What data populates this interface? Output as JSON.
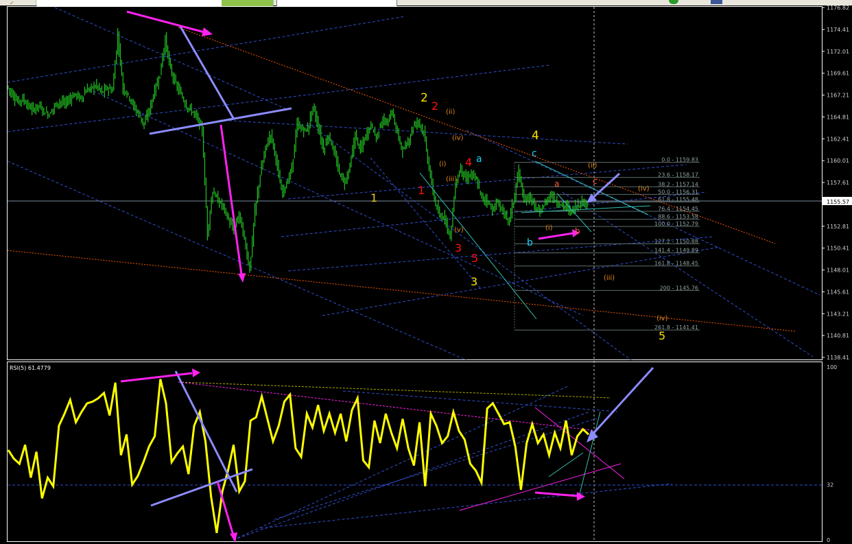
{
  "rsi_label": "RSI(5) 61.4779",
  "price_axis": [
    "1176.82",
    "1174.41",
    "1172.01",
    "1169.61",
    "1167.21",
    "1164.81",
    "1162.41",
    "1160.01",
    "1157.61",
    "1155.57",
    "1152.81",
    "1150.41",
    "1148.01",
    "1145.61",
    "1143.21",
    "1140.81",
    "1138.41"
  ],
  "current_price": "1155.57",
  "rsi_axis": [
    "100",
    "32",
    "0"
  ],
  "fib_levels": [
    "0.0 - 1159.83",
    "23.6 - 1158.17",
    "38.2 - 1157.14",
    "50.0 - 1156.31",
    "61.8 - 1155.48",
    "76.4 - 1154.45",
    "88.6 - 1153.58",
    "100.0 - 1152.79",
    "127.2 - 1150.88",
    "141.4 - 1149.89",
    "161.8 - 1148.45",
    "200 - 1145.76",
    "261.8 - 1141.41"
  ],
  "wave_labels": {
    "y1": "1",
    "y2": "2",
    "y3": "3",
    "y4": "4",
    "y5": "5",
    "r1": "1",
    "r2": "2",
    "r3": "3",
    "r4": "4",
    "r5": "5",
    "a_cyan": "a",
    "b_cyan": "b",
    "c_cyan": "c",
    "a_small": "a",
    "b_small": "b",
    "c_small": "c",
    "ii": "(ii)",
    "iii": "(iii)",
    "iv": "(iv)",
    "i": "(i)",
    "v": "(v)",
    "ii2": "(ii)",
    "iv2": "(iv)",
    "iii2": "(iii)",
    "iv3": "(iv)",
    "i2": "(i)"
  },
  "colors": {
    "candle": "#22c322",
    "rsi": "#ffff00",
    "magenta": "#ff22ee",
    "lavender": "#8c8cff",
    "channel": "#3050d0",
    "orange": "#ff5a00",
    "cyan": "#00e0e0"
  },
  "chart_data": {
    "type": "candlestick",
    "ylim": [
      1138.41,
      1176.82
    ],
    "current_price": 1155.57,
    "rsi": {
      "period": 5,
      "last": 61.4779,
      "ylim": [
        0,
        100
      ],
      "level": 32
    },
    "fib_retracement": [
      {
        "ratio": 0.0,
        "price": 1159.83
      },
      {
        "ratio": 23.6,
        "price": 1158.17
      },
      {
        "ratio": 38.2,
        "price": 1157.14
      },
      {
        "ratio": 50.0,
        "price": 1156.31
      },
      {
        "ratio": 61.8,
        "price": 1155.48
      },
      {
        "ratio": 76.4,
        "price": 1154.45
      },
      {
        "ratio": 88.6,
        "price": 1153.58
      },
      {
        "ratio": 100.0,
        "price": 1152.79
      },
      {
        "ratio": 127.2,
        "price": 1150.88
      },
      {
        "ratio": 141.4,
        "price": 1149.89
      },
      {
        "ratio": 161.8,
        "price": 1148.45
      },
      {
        "ratio": 200,
        "price": 1145.76
      },
      {
        "ratio": 261.8,
        "price": 1141.41
      }
    ],
    "price_path": [
      1168.2,
      1167.3,
      1166.5,
      1166.8,
      1166.0,
      1165.6,
      1166.1,
      1165.4,
      1165.1,
      1166.0,
      1166.5,
      1166.3,
      1166.9,
      1167.3,
      1166.8,
      1167.7,
      1168.0,
      1168.3,
      1167.5,
      1168.0,
      1167.7,
      1173.8,
      1168.0,
      1167.2,
      1166.0,
      1165.1,
      1164.0,
      1165.6,
      1167.7,
      1169.5,
      1173.3,
      1170.0,
      1168.4,
      1167.3,
      1166.0,
      1165.5,
      1164.8,
      1163.4,
      1152.0,
      1156.7,
      1155.6,
      1155.0,
      1153.5,
      1152.3,
      1154.2,
      1151.4,
      1148.0,
      1154.5,
      1158.4,
      1161.4,
      1163.0,
      1160.3,
      1156.6,
      1157.4,
      1159.2,
      1164.0,
      1163.4,
      1163.4,
      1166.0,
      1163.7,
      1161.2,
      1162.8,
      1160.9,
      1158.7,
      1157.6,
      1159.4,
      1162.8,
      1161.2,
      1162.7,
      1164.0,
      1162.5,
      1164.4,
      1164.1,
      1165.4,
      1163.0,
      1161.1,
      1162.0,
      1163.8,
      1164.4,
      1163.1,
      1159.2,
      1155.8,
      1153.8,
      1153.9,
      1151.6,
      1157.3,
      1159.3,
      1157.9,
      1158.6,
      1157.8,
      1155.9,
      1155.7,
      1154.6,
      1155.4,
      1154.5,
      1153.3,
      1155.5,
      1159.0,
      1155.4,
      1156.2,
      1155.0,
      1154.3,
      1155.3,
      1156.3,
      1155.6,
      1155.1,
      1155.0,
      1154.4,
      1155.1,
      1155.4,
      1155.6
    ],
    "rsi_path": [
      52,
      47,
      44,
      55,
      36,
      51,
      24,
      36,
      31,
      66,
      73,
      81,
      68,
      74,
      79,
      80,
      82,
      85,
      72,
      91,
      49,
      61,
      32,
      37,
      45,
      54,
      60,
      93,
      79,
      45,
      50,
      54,
      38,
      66,
      74,
      57,
      25,
      4,
      28,
      40,
      55,
      28,
      34,
      69,
      71,
      83,
      70,
      57,
      66,
      80,
      84,
      53,
      48,
      73,
      65,
      78,
      63,
      73,
      62,
      73,
      57,
      75,
      82,
      46,
      42,
      69,
      56,
      73,
      62,
      53,
      70,
      53,
      43,
      68,
      31,
      73,
      66,
      56,
      60,
      74,
      63,
      58,
      44,
      40,
      33,
      76,
      79,
      73,
      67,
      68,
      54,
      29,
      56,
      67,
      56,
      61,
      49,
      62,
      53,
      69,
      49,
      60,
      64,
      61
    ]
  }
}
